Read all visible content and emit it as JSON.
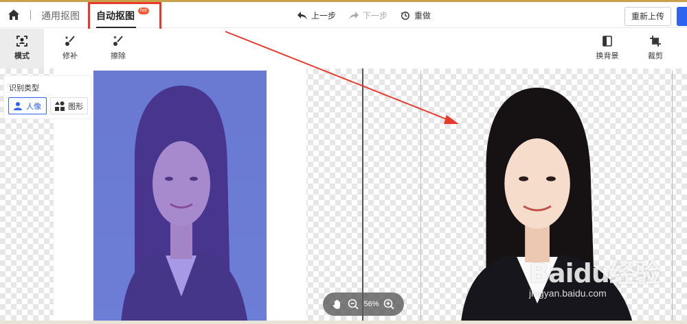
{
  "header": {
    "tab_general": "通用抠图",
    "tab_auto": "自动抠图",
    "hot_badge": "hot",
    "undo": "上一步",
    "redo": "下一步",
    "redo_all": "重做",
    "reupload": "重新上传"
  },
  "toolbar": {
    "mode": "模式",
    "repair": "修补",
    "erase": "擦除",
    "change_bg": "换背景",
    "crop": "裁剪"
  },
  "panel": {
    "title": "识别类型",
    "person": "人像",
    "shape": "图形"
  },
  "zoom": {
    "level": "56%"
  },
  "watermark": {
    "brand": "Baidu经验",
    "url": "jingyan.baidu.com"
  },
  "colors": {
    "accent": "#2c64f0",
    "highlight": "#e8392d",
    "photo_bg": "#6aaecb",
    "mask_overlay": "#6a4fd8"
  }
}
